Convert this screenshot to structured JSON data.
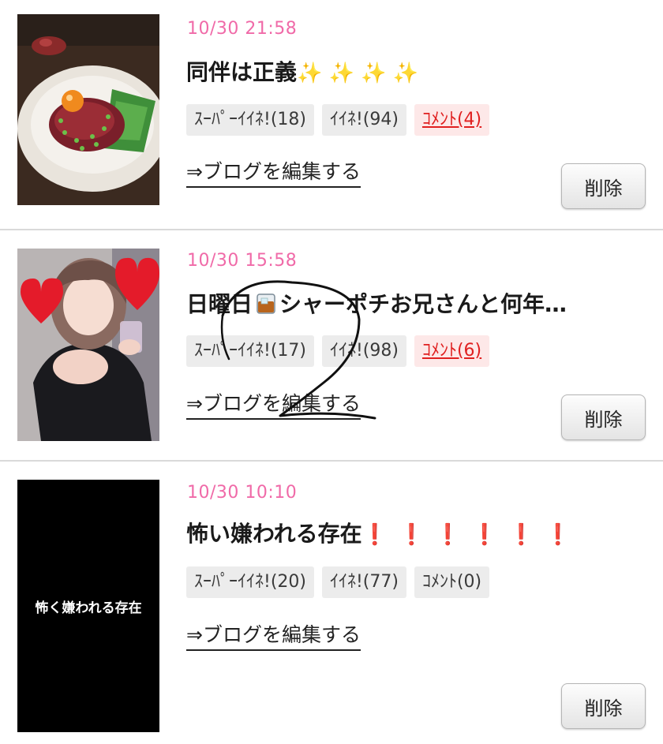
{
  "posts": [
    {
      "date": "10/30 21:58",
      "title": "同伴は正義",
      "title_deco": "✨ ✨ ✨ ✨",
      "badges": {
        "super_like": "ｽｰﾊﾟｰｲｲﾈ!(18)",
        "like": "ｲｲﾈ!(94)",
        "comment": "ｺﾒﾝﾄ(4)"
      },
      "comment_active": true,
      "edit_link": "⇒ブログを編集する",
      "delete_label": "削除"
    },
    {
      "date": "10/30 15:58",
      "title_pre": "日曜日",
      "title_post": "シャーポチお兄さんと何年…",
      "badges": {
        "super_like": "ｽｰﾊﾟｰｲｲﾈ!(17)",
        "like": "ｲｲﾈ!(98)",
        "comment": "ｺﾒﾝﾄ(6)"
      },
      "comment_active": true,
      "edit_link": "⇒ブログを編集する",
      "delete_label": "削除"
    },
    {
      "date": "10/30 10:10",
      "title": "怖い嫌われる存在",
      "title_deco": "❗❗❗❗❗❗",
      "thumb_text": "怖く嫌われる存在",
      "badges": {
        "super_like": "ｽｰﾊﾟｰｲｲﾈ!(20)",
        "like": "ｲｲﾈ!(77)",
        "comment": "ｺﾒﾝﾄ(0)"
      },
      "comment_active": false,
      "edit_link": "⇒ブログを編集する",
      "delete_label": "削除"
    }
  ],
  "colors": {
    "date": "#f06aa8",
    "comment_active": "#e02020",
    "divider": "#d9d9d9"
  }
}
